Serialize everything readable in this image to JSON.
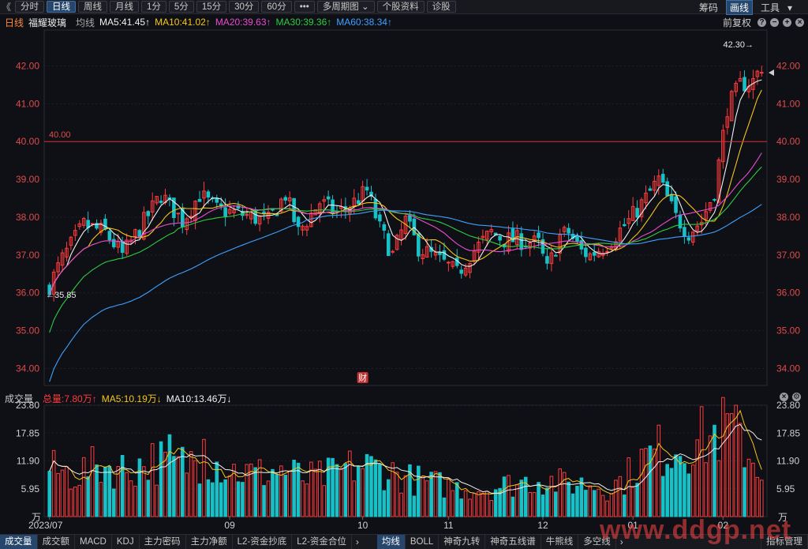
{
  "toolbar": {
    "back": "《",
    "periods": [
      "分时",
      "日线",
      "周线",
      "月线",
      "1分",
      "5分",
      "15分",
      "30分",
      "60分"
    ],
    "active_period": 1,
    "more": "•••",
    "multi_period": "多周期图",
    "multi_period_arrow": "⌄",
    "profile": "个股资料",
    "diagnose": "诊股",
    "chip": "筹码",
    "draw": "画线",
    "tools": "工具",
    "tools_arrow": "▾"
  },
  "indicator_bar": {
    "period_label": "日线",
    "stock_name": "福耀玻璃",
    "avg_label": "均线",
    "ma": [
      {
        "text": "MA5:41.45↑",
        "color": "#f0f0f0"
      },
      {
        "text": "MA10:41.02↑",
        "color": "#f5c518"
      },
      {
        "text": "MA20:39.63↑",
        "color": "#e84ccf"
      },
      {
        "text": "MA30:39.36↑",
        "color": "#2ecc40"
      },
      {
        "text": "MA60:38.34↑",
        "color": "#3ea1ff"
      }
    ],
    "adjust": "前复权",
    "icons": [
      "?",
      "−",
      "+",
      "×"
    ]
  },
  "volume_bar": {
    "label": "成交量",
    "total": "总量:7.80万↑",
    "ma5": "MA5:10.19万↓",
    "ma10": "MA10:13.46万↓",
    "close_icon": "×",
    "settings_icon": "⚙"
  },
  "bottom_tabs": {
    "left": [
      "成交量",
      "成交额",
      "MACD",
      "KDJ",
      "主力密码",
      "主力净额",
      "L2-资金抄底",
      "L2-资金合位"
    ],
    "active_left": 0,
    "arrow": "›",
    "right": [
      "均线",
      "BOLL",
      "神奇九转",
      "神奇五线谱",
      "牛熊线",
      "多空线"
    ],
    "active_right": 0,
    "indicator_manage": "指标管理",
    "watermark": "www.ddgp.net"
  },
  "colors": {
    "up": "#ff3b3b",
    "down": "#16c2c8",
    "ma5": "#f0f0f0",
    "ma10": "#f5c518",
    "ma20": "#e84ccf",
    "ma30": "#2ecc40",
    "ma60": "#3ea1ff",
    "line40": "#d93030"
  },
  "chart_data": {
    "type": "candlestick",
    "price_axis": {
      "ticks": [
        "42.00",
        "41.00",
        "40.00",
        "39.00",
        "38.00",
        "37.00",
        "36.00",
        "35.00",
        "34.00"
      ],
      "range": [
        33.55,
        42.95
      ]
    },
    "volume_axis": {
      "ticks": [
        "23.80",
        "17.85",
        "11.90",
        "5.95"
      ],
      "unit": "万",
      "range": [
        0,
        23.8
      ]
    },
    "x_ticks": [
      {
        "label": "2023/07",
        "index": 0
      },
      {
        "label": "09",
        "index": 42
      },
      {
        "label": "10",
        "index": 73
      },
      {
        "label": "11",
        "index": 93
      },
      {
        "label": "12",
        "index": 115
      },
      {
        "label": "01",
        "index": 136
      },
      {
        "label": "02",
        "index": 157
      }
    ],
    "hline": {
      "value": 40.0,
      "label": "40.00"
    },
    "max_label": "42.30→",
    "min_label": "←35.85",
    "event_marker": {
      "label": "财",
      "index": 73
    },
    "trend": [
      [
        0,
        36.2
      ],
      [
        3,
        36.9
      ],
      [
        8,
        37.8
      ],
      [
        13,
        37.6
      ],
      [
        17,
        37.0
      ],
      [
        21,
        37.7
      ],
      [
        26,
        38.6
      ],
      [
        31,
        37.9
      ],
      [
        35,
        38.6
      ],
      [
        39,
        38.2
      ],
      [
        44,
        38.1
      ],
      [
        51,
        37.9
      ],
      [
        55,
        38.6
      ],
      [
        58,
        37.6
      ],
      [
        63,
        38.4
      ],
      [
        67,
        38.1
      ],
      [
        70,
        38.3
      ],
      [
        74,
        38.7
      ],
      [
        77,
        37.7
      ],
      [
        80,
        37.0
      ],
      [
        83,
        37.9
      ],
      [
        86,
        37.2
      ],
      [
        89,
        37.0
      ],
      [
        93,
        36.7
      ],
      [
        95,
        36.5
      ],
      [
        98,
        37.0
      ],
      [
        103,
        37.6
      ],
      [
        106,
        37.4
      ],
      [
        109,
        37.4
      ],
      [
        114,
        37.3
      ],
      [
        116,
        36.6
      ],
      [
        119,
        37.5
      ],
      [
        121,
        37.6
      ],
      [
        124,
        37.1
      ],
      [
        126,
        37.0
      ],
      [
        130,
        37.3
      ],
      [
        135,
        37.9
      ],
      [
        139,
        38.5
      ],
      [
        142,
        39.0
      ],
      [
        146,
        38.0
      ],
      [
        149,
        37.6
      ],
      [
        152,
        37.9
      ],
      [
        155,
        38.7
      ],
      [
        158,
        40.9
      ],
      [
        161,
        41.5
      ],
      [
        164,
        41.6
      ],
      [
        166,
        42.0
      ]
    ],
    "volume_trend": [
      [
        0,
        10
      ],
      [
        6,
        9
      ],
      [
        12,
        11
      ],
      [
        18,
        10
      ],
      [
        24,
        12
      ],
      [
        30,
        11
      ],
      [
        36,
        13
      ],
      [
        42,
        10
      ],
      [
        48,
        9
      ],
      [
        54,
        10
      ],
      [
        60,
        8
      ],
      [
        66,
        9
      ],
      [
        72,
        11
      ],
      [
        78,
        10
      ],
      [
        84,
        8
      ],
      [
        90,
        7
      ],
      [
        96,
        6
      ],
      [
        102,
        6
      ],
      [
        108,
        7
      ],
      [
        114,
        8
      ],
      [
        120,
        7
      ],
      [
        126,
        7
      ],
      [
        130,
        6
      ],
      [
        134,
        8
      ],
      [
        138,
        12
      ],
      [
        142,
        14
      ],
      [
        146,
        15
      ],
      [
        150,
        16
      ],
      [
        154,
        17
      ],
      [
        158,
        19
      ],
      [
        161,
        17
      ],
      [
        164,
        12
      ],
      [
        166,
        9
      ]
    ],
    "volume_spikes": [
      {
        "index": 160,
        "value": 23.8
      },
      {
        "index": 28,
        "value": 17.5
      },
      {
        "index": 36,
        "value": 16.5
      }
    ],
    "candle_count": 167,
    "last_volume": 7.8,
    "ma_volume": [
      {
        "name": "MA5",
        "color": "#f5c518"
      },
      {
        "name": "MA10",
        "color": "#f0f0f0"
      }
    ]
  }
}
